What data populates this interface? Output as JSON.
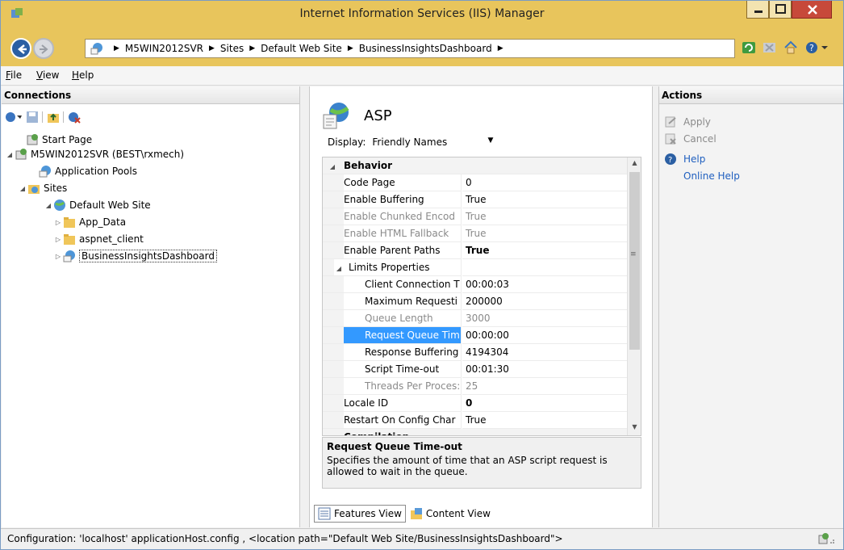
{
  "window": {
    "title": "Internet Information Services (IIS) Manager"
  },
  "address": {
    "crumbs": [
      "M5WIN2012SVR",
      "Sites",
      "Default Web Site",
      "BusinessInsightsDashboard"
    ]
  },
  "menu": {
    "items": [
      "File",
      "View",
      "Help"
    ]
  },
  "connections": {
    "header": "Connections",
    "tree": [
      {
        "label": "Start Page"
      },
      {
        "label": "M5WIN2012SVR (BEST\\rxmech)"
      },
      {
        "label": "Application Pools"
      },
      {
        "label": "Sites"
      },
      {
        "label": "Default Web Site"
      },
      {
        "label": "App_Data"
      },
      {
        "label": "aspnet_client"
      },
      {
        "label": "BusinessInsightsDashboard"
      }
    ]
  },
  "feature": {
    "title": "ASP",
    "display_label": "Display:",
    "display_value": "Friendly Names",
    "grid": [
      {
        "key": "Behavior",
        "value": ""
      },
      {
        "key": "Code Page",
        "value": "0"
      },
      {
        "key": "Enable Buffering",
        "value": "True"
      },
      {
        "key": "Enable Chunked Encod",
        "value": "True"
      },
      {
        "key": "Enable HTML Fallback",
        "value": "True"
      },
      {
        "key": "Enable Parent Paths",
        "value": "True"
      },
      {
        "key": "Limits Properties",
        "value": ""
      },
      {
        "key": "Client Connection T",
        "value": "00:00:03"
      },
      {
        "key": "Maximum Requesti",
        "value": "200000"
      },
      {
        "key": "Queue Length",
        "value": "3000"
      },
      {
        "key": "Request Queue Tim",
        "value": "00:00:00"
      },
      {
        "key": "Response Buffering",
        "value": "4194304"
      },
      {
        "key": "Script Time-out",
        "value": "00:01:30"
      },
      {
        "key": "Threads Per Proces:",
        "value": "25"
      },
      {
        "key": "Locale ID",
        "value": "0"
      },
      {
        "key": "Restart On Config Char",
        "value": "True"
      },
      {
        "key": "Compilation",
        "value": ""
      }
    ],
    "description_title": "Request Queue Time-out",
    "description_text": "Specifies the amount of time that an ASP script request is allowed to wait in the queue.",
    "view_tabs": [
      "Features View",
      "Content View"
    ]
  },
  "actions": {
    "header": "Actions",
    "items": [
      "Apply",
      "Cancel",
      "Help",
      "Online Help"
    ]
  },
  "status": {
    "text": "Configuration: 'localhost' applicationHost.config , <location path=\"Default Web Site/BusinessInsightsDashboard\">"
  }
}
